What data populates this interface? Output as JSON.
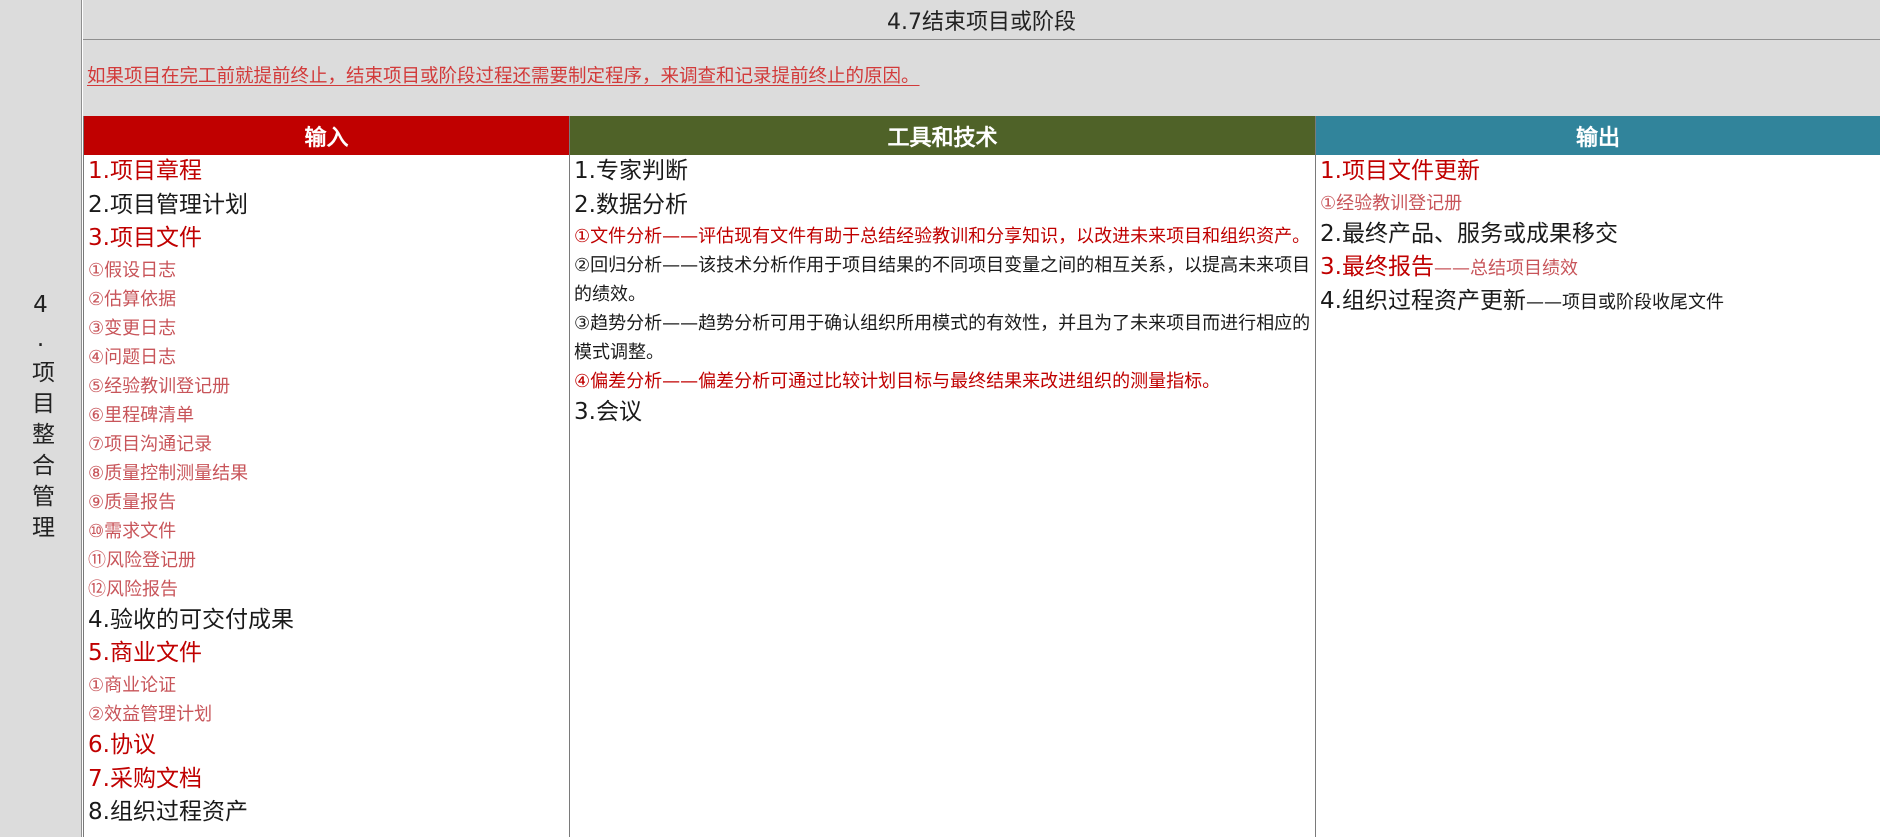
{
  "side_label": "4.项目整合管理",
  "title": "4.7结束项目或阶段",
  "note": "如果项目在完工前就提前终止，结束项目或阶段过程还需要制定程序，来调查和记录提前终止的原因。",
  "columns": {
    "inputs": {
      "header": "输入"
    },
    "tools": {
      "header": "工具和技术"
    },
    "outputs": {
      "header": "输出"
    }
  },
  "inputs": [
    "1.项目章程",
    "2.项目管理计划",
    "3.项目文件",
    "①假设日志",
    "②估算依据",
    "③变更日志",
    "④问题日志",
    "⑤经验教训登记册",
    "⑥里程碑清单",
    "⑦项目沟通记录",
    "⑧质量控制测量结果",
    "⑨质量报告",
    "⑩需求文件",
    "⑪风险登记册",
    "⑫风险报告",
    "4.验收的可交付成果",
    "5.商业文件",
    "①商业论证",
    "②效益管理计划",
    "6.协议",
    "7.采购文档",
    "8.组织过程资产"
  ],
  "tools": [
    "1.专家判断",
    "2.数据分析",
    "①文件分析——评估现有文件有助于总结经验教训和分享知识，以改进未来项目和组织资产。",
    "②回归分析——该技术分析作用于项目结果的不同项目变量之间的相互关系，以提高未来项目的绩效。",
    "③趋势分析——趋势分析可用于确认组织所用模式的有效性，并且为了未来项目而进行相应的模式调整。",
    "④偏差分析——偏差分析可通过比较计划目标与最终结果来改进组织的测量指标。",
    "3.会议"
  ],
  "outputs": [
    "1.项目文件更新",
    "①经验教训登记册",
    "2.最终产品、服务或成果移交",
    "3.最终报告",
    "——总结项目绩效",
    "4.组织过程资产更新",
    "——项目或阶段收尾文件"
  ],
  "colors": {
    "input_header": "#c00000",
    "tools_header": "#4f6228",
    "output_header": "#31849b",
    "highlight_red": "#c00000",
    "note_red": "#d23a3a",
    "band_gray": "#dcdcdc"
  }
}
